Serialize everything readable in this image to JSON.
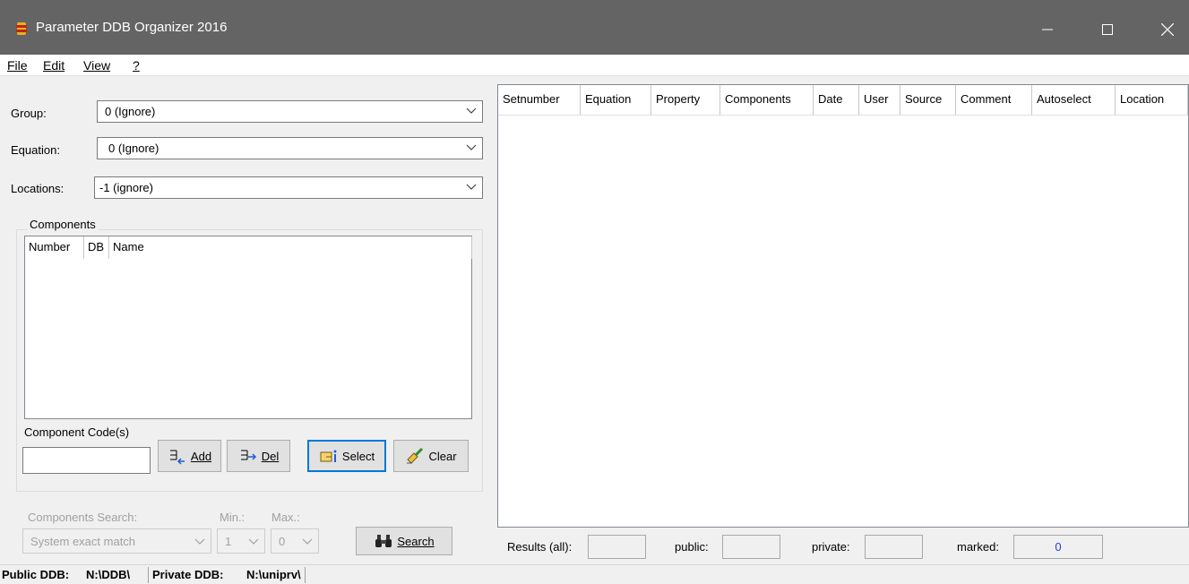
{
  "window": {
    "title": "Parameter DDB Organizer 2016",
    "title_bar_color": "#646464"
  },
  "menu": {
    "file": "File",
    "edit": "Edit",
    "view": "View",
    "help": "?"
  },
  "filters": {
    "group_label": "Group:",
    "group_value": "0 (Ignore)",
    "equation_label": "Equation:",
    "equation_value": "0 (Ignore)",
    "locations_label": "Locations:",
    "locations_value": "-1 (ignore)"
  },
  "components": {
    "title": "Components",
    "columns": [
      "Number",
      "DB",
      "Name"
    ],
    "code_label": "Component Code(s)",
    "code_value": "",
    "buttons": {
      "add": "Add",
      "del": "Del",
      "select": "Select",
      "clear": "Clear"
    }
  },
  "search": {
    "mode_label": "Components Search:",
    "min_label": "Min.:",
    "max_label": "Max.:",
    "mode_value": "System exact match",
    "min_value": "1",
    "max_value": "0",
    "button": "Search"
  },
  "results": {
    "columns": [
      "Setnumber",
      "Equation",
      "Property",
      "Components",
      "Date",
      "User",
      "Source",
      "Comment",
      "Autoselect",
      "Location"
    ],
    "all_label": "Results (all):",
    "public_label": "public:",
    "private_label": "private:",
    "marked_label": "marked:",
    "all_value": "",
    "public_value": "",
    "private_value": "",
    "marked_value": "0"
  },
  "statusbar": {
    "public_label": "Public DDB:",
    "public_path": "N:\\DDB\\",
    "private_label": "Private DDB:",
    "private_path": "N:\\uniprv\\"
  },
  "icons": {
    "app": "ddb-organizer-icon",
    "search": "binoculars-icon",
    "add": "add-arrow-icon",
    "del": "del-arrow-icon",
    "select": "select-pointer-icon",
    "clear": "eraser-icon"
  },
  "colors": {
    "accent": "#0078d7",
    "marked_value": "#1f3fd0"
  }
}
